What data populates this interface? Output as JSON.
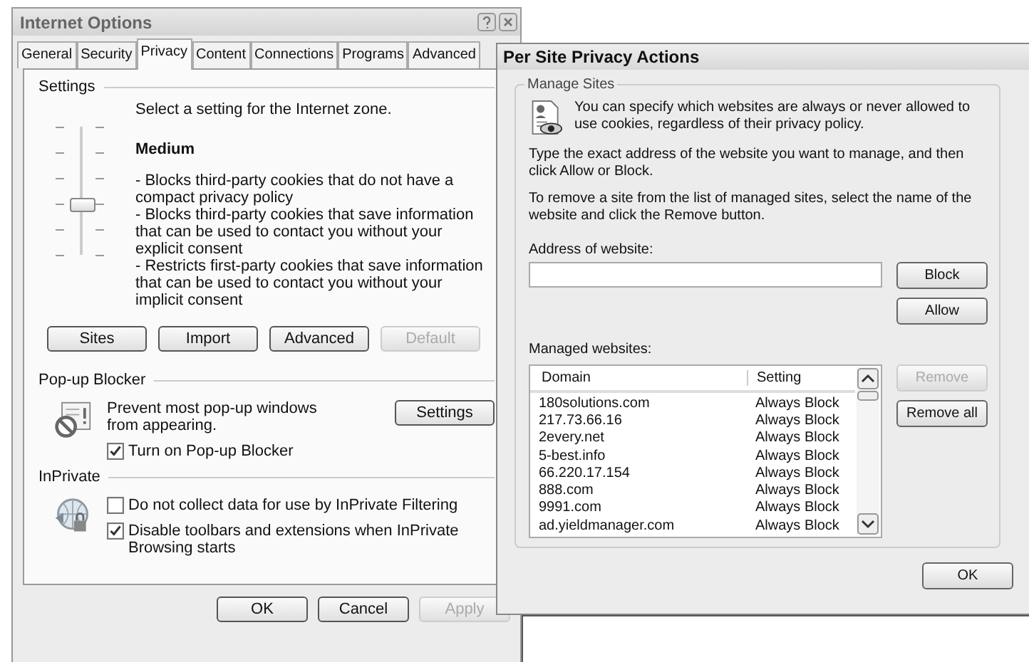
{
  "internet_options": {
    "title": "Internet Options",
    "tabs": [
      {
        "label": "General",
        "selected": false
      },
      {
        "label": "Security",
        "selected": false
      },
      {
        "label": "Privacy",
        "selected": true
      },
      {
        "label": "Content",
        "selected": false
      },
      {
        "label": "Connections",
        "selected": false
      },
      {
        "label": "Programs",
        "selected": false
      },
      {
        "label": "Advanced",
        "selected": false
      }
    ],
    "settings": {
      "heading": "Settings",
      "intro": "Select a setting for the Internet zone.",
      "level_name": "Medium",
      "slider": {
        "level": 0.4
      },
      "description": [
        "- Blocks third-party cookies that do not have a compact privacy policy",
        "- Blocks third-party cookies that save information that can be used to contact you without your explicit consent",
        "- Restricts first-party cookies that save information that can be used to contact you without your implicit consent"
      ],
      "buttons": [
        {
          "label": "Sites",
          "disabled": false
        },
        {
          "label": "Import",
          "disabled": false
        },
        {
          "label": "Advanced",
          "disabled": false
        },
        {
          "label": "Default",
          "disabled": true
        }
      ]
    },
    "popup_blocker": {
      "heading": "Pop-up Blocker",
      "text": "Prevent most pop-up windows from appearing.",
      "settings_button": "Settings",
      "checkbox": {
        "label": "Turn on Pop-up Blocker",
        "checked": true
      }
    },
    "inprivate": {
      "heading": "InPrivate",
      "checkboxes": [
        {
          "label": "Do not collect data for use by InPrivate Filtering",
          "checked": false
        },
        {
          "label": "Disable toolbars and extensions when InPrivate Browsing starts",
          "checked": true
        }
      ]
    },
    "buttons": [
      {
        "label": "OK",
        "disabled": false
      },
      {
        "label": "Cancel",
        "disabled": false
      },
      {
        "label": "Apply",
        "disabled": true
      }
    ]
  },
  "per_site": {
    "title": "Per Site Privacy Actions",
    "group": "Manage Sites",
    "intro": "You can specify which websites are always or never allowed to use cookies, regardless of their privacy policy.",
    "instructions": [
      "Type the exact address of the website you want to manage, and then click Allow or Block.",
      "To remove a site from the list of managed sites, select the name of the website and click the Remove button."
    ],
    "address_label": "Address of website:",
    "side_buttons": [
      {
        "label": "Block",
        "disabled": false
      },
      {
        "label": "Allow",
        "disabled": false
      }
    ],
    "managed_label": "Managed websites:",
    "columns": [
      "Domain",
      "Setting"
    ],
    "rows": [
      {
        "domain": "180solutions.com",
        "setting": "Always Block"
      },
      {
        "domain": "217.73.66.16",
        "setting": "Always Block"
      },
      {
        "domain": "2every.net",
        "setting": "Always Block"
      },
      {
        "domain": "5-best.info",
        "setting": "Always Block"
      },
      {
        "domain": "66.220.17.154",
        "setting": "Always Block"
      },
      {
        "domain": "888.com",
        "setting": "Always Block"
      },
      {
        "domain": "9991.com",
        "setting": "Always Block"
      },
      {
        "domain": "ad.yieldmanager.com",
        "setting": "Always Block"
      }
    ],
    "list_buttons": [
      {
        "label": "Remove",
        "disabled": true
      },
      {
        "label": "Remove all",
        "disabled": false
      }
    ],
    "ok": "OK"
  }
}
